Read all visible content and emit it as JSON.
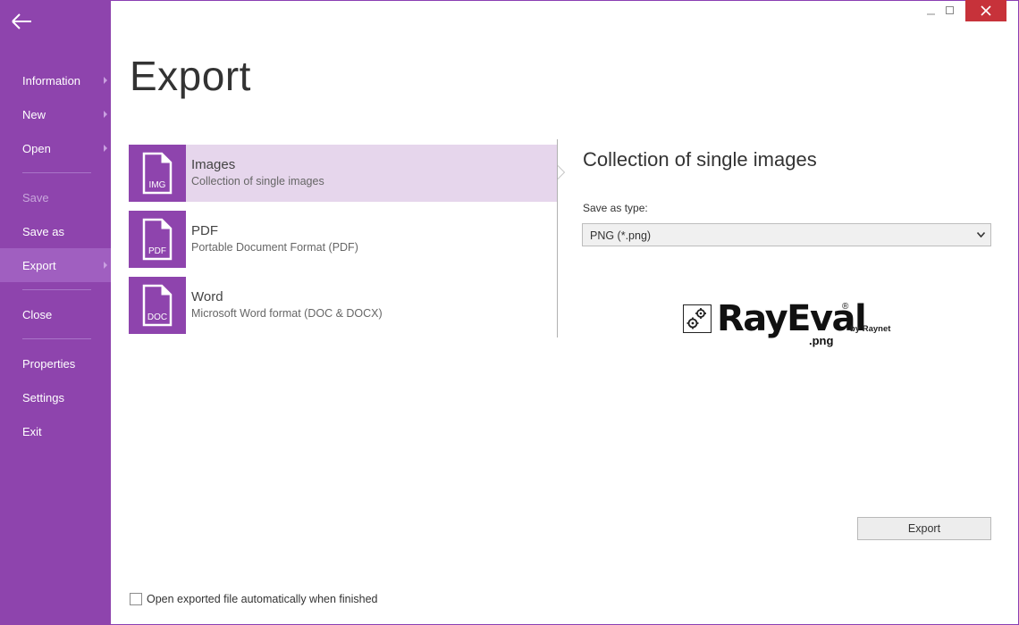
{
  "sidebar": {
    "items": [
      {
        "label": "Information",
        "has_arrow": true
      },
      {
        "label": "New",
        "has_arrow": true
      },
      {
        "label": "Open",
        "has_arrow": true
      },
      {
        "label": "Save",
        "disabled": true
      },
      {
        "label": "Save as"
      },
      {
        "label": "Export",
        "active": true,
        "has_arrow": true
      },
      {
        "label": "Close"
      },
      {
        "label": "Properties"
      },
      {
        "label": "Settings"
      },
      {
        "label": "Exit"
      }
    ]
  },
  "page": {
    "title": "Export"
  },
  "formats": [
    {
      "tile_label": "IMG",
      "name": "Images",
      "desc": "Collection of single images",
      "selected": true
    },
    {
      "tile_label": "PDF",
      "name": "PDF",
      "desc": "Portable Document Format (PDF)"
    },
    {
      "tile_label": "DOC",
      "name": "Word",
      "desc": "Microsoft Word format (DOC & DOCX)"
    }
  ],
  "detail": {
    "title": "Collection of single images",
    "save_type_label": "Save as type:",
    "save_type_value": "PNG (*.png)"
  },
  "logo": {
    "name": "RayEval",
    "reg": "®",
    "ext": ".png",
    "by": "by Raynet"
  },
  "actions": {
    "export_label": "Export"
  },
  "options": {
    "open_after_export_label": "Open exported file automatically when finished",
    "open_after_export_checked": false
  },
  "colors": {
    "accent": "#8e44ad",
    "selected_bg": "#e6d6ec",
    "close_button": "#c7323a"
  },
  "icons": {
    "back": "arrow-left-icon",
    "file": "file-icon",
    "dropdown": "chevron-down-icon"
  }
}
